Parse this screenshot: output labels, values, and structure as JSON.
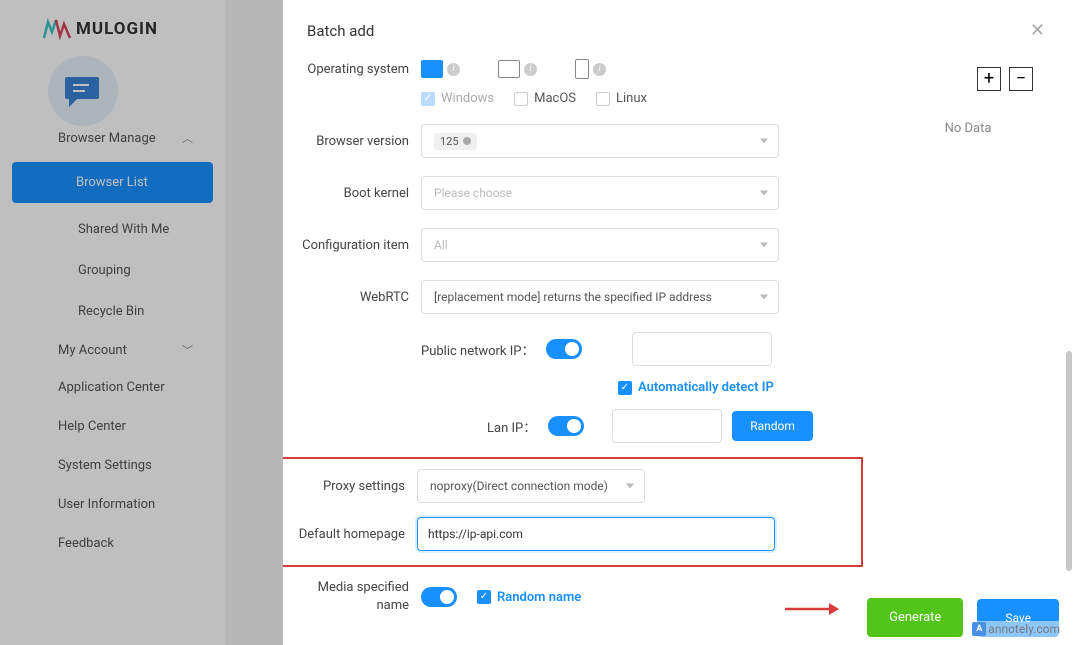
{
  "brand": {
    "name": "MULOGIN"
  },
  "sidebar": {
    "browser_manage": "Browser Manage",
    "items": [
      "Browser List",
      "Shared With Me",
      "Grouping",
      "Recycle Bin"
    ],
    "my_account": "My Account",
    "links": [
      "Application Center",
      "Help Center",
      "System Settings",
      "User Information",
      "Feedback"
    ]
  },
  "modal": {
    "title": "Batch add",
    "no_data": "No Data",
    "labels": {
      "os": "Operating system",
      "browser_version": "Browser version",
      "boot_kernel": "Boot kernel",
      "config_item": "Configuration item",
      "webrtc": "WebRTC",
      "public_ip": "Public network IP：",
      "auto_detect": "Automatically detect IP",
      "lan_ip": "Lan IP：",
      "random": "Random",
      "proxy": "Proxy settings",
      "homepage": "Default homepage",
      "media_name": "Media specified name",
      "random_name": "Random name"
    },
    "os_options": {
      "windows": "Windows",
      "macos": "MacOS",
      "linux": "Linux"
    },
    "values": {
      "browser_version": "125",
      "boot_kernel_placeholder": "Please choose",
      "config_item": "All",
      "webrtc": "[replacement mode] returns the specified IP address",
      "proxy": "noproxy(Direct connection mode)",
      "homepage": "https://ip-api.com"
    },
    "buttons": {
      "generate": "Generate",
      "save": "Save",
      "plus": "+",
      "minus": "−"
    }
  },
  "watermark": "annotely.com"
}
